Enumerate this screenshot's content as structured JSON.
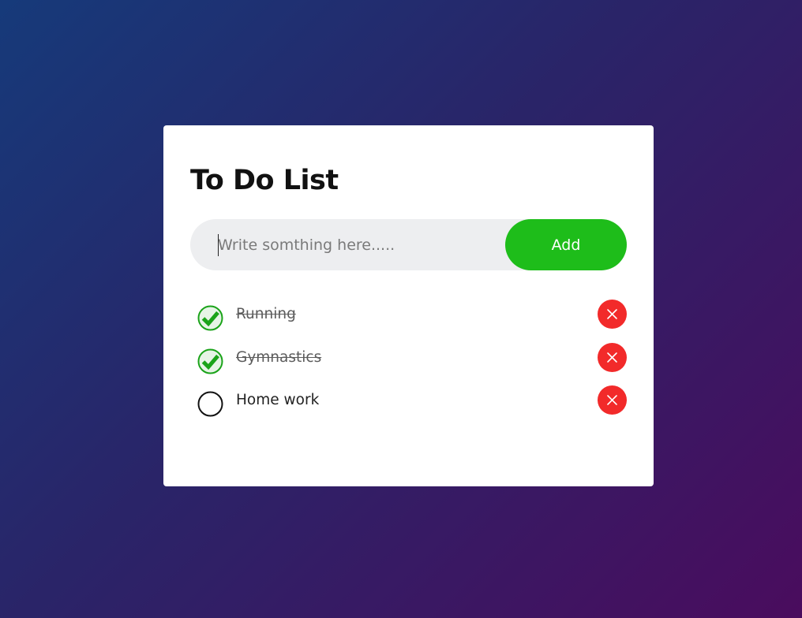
{
  "app": {
    "title": "To Do List"
  },
  "input": {
    "placeholder": "Write somthing here.....",
    "value": ""
  },
  "add_button": {
    "label": "Add"
  },
  "tasks": [
    {
      "label": "Running",
      "done": true
    },
    {
      "label": "Gymnastics",
      "done": true
    },
    {
      "label": "Home work",
      "done": false
    }
  ],
  "colors": {
    "accent_green": "#1ebd1a",
    "check_green": "#1aa319",
    "delete_red": "#f22a2a",
    "input_bg": "#edeef0",
    "card_bg": "#ffffff"
  },
  "icons": {
    "checked": "checkmark-circle-icon",
    "unchecked": "empty-circle-icon",
    "delete": "close-icon"
  }
}
